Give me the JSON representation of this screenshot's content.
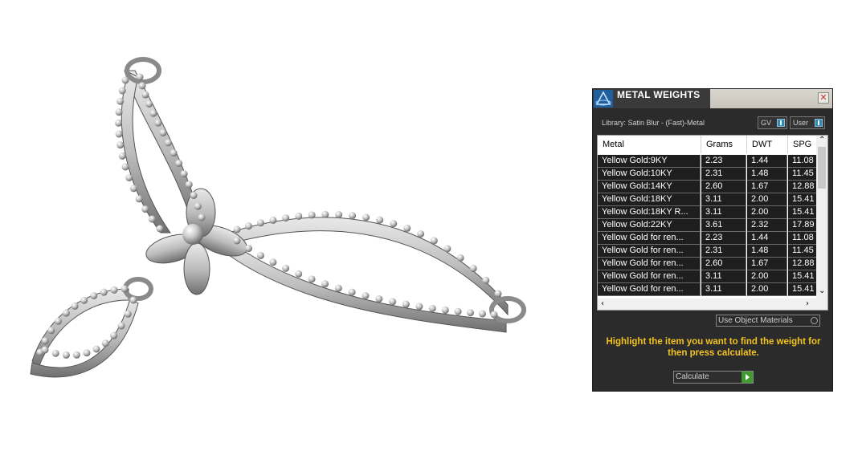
{
  "panel": {
    "title": "METAL WEIGHTS",
    "close_label": "✕",
    "library": "Library: Satin Blur - (Fast)-Metal",
    "toggle_gv": "GV",
    "toggle_user": "User",
    "use_object_materials": "Use Object Materials",
    "instruction": "Highlight the item you want to find the weight for then press calculate.",
    "calculate": "Calculate"
  },
  "table": {
    "columns": [
      "Metal",
      "Grams",
      "DWT",
      "SPG"
    ],
    "rows": [
      [
        "Yellow Gold:9KY",
        "2.23",
        "1.44",
        "11.08"
      ],
      [
        "Yellow Gold:10KY",
        "2.31",
        "1.48",
        "11.45"
      ],
      [
        "Yellow Gold:14KY",
        "2.60",
        "1.67",
        "12.88"
      ],
      [
        "Yellow Gold:18KY",
        "3.11",
        "2.00",
        "15.41"
      ],
      [
        "Yellow Gold:18KY R...",
        "3.11",
        "2.00",
        "15.41"
      ],
      [
        "Yellow Gold:22KY",
        "3.61",
        "2.32",
        "17.89"
      ],
      [
        "Yellow Gold for ren...",
        "2.23",
        "1.44",
        "11.08"
      ],
      [
        "Yellow Gold for ren...",
        "2.31",
        "1.48",
        "11.45"
      ],
      [
        "Yellow Gold for ren...",
        "2.60",
        "1.67",
        "12.88"
      ],
      [
        "Yellow Gold for ren...",
        "3.11",
        "2.00",
        "15.41"
      ],
      [
        "Yellow Gold for ren...",
        "3.11",
        "2.00",
        "15.41"
      ]
    ]
  },
  "colors": {
    "panel_bg": "#2b2b2b",
    "highlight_text": "#f3c31f",
    "toggle_accent": "#2d8ab0",
    "go_button": "#3f9b2d"
  },
  "icons": [
    "app-logo-icon",
    "close-icon",
    "scroll-up-icon",
    "scroll-down-icon",
    "scroll-left-icon",
    "scroll-right-icon",
    "play-icon"
  ]
}
